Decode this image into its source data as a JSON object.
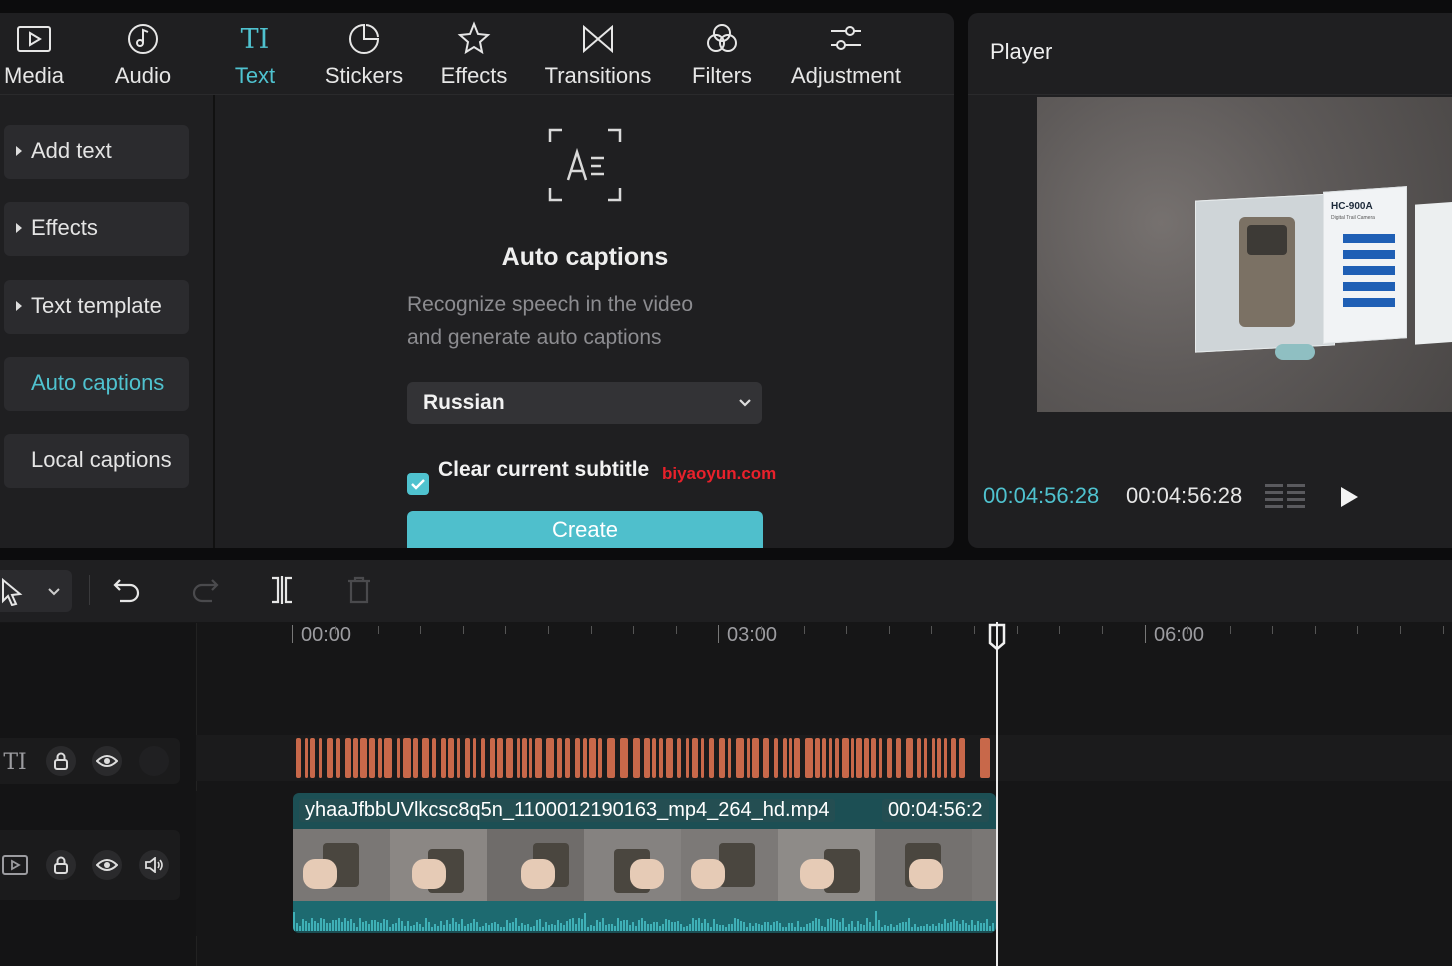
{
  "tabs": [
    {
      "label": "Media",
      "icon": "media-icon"
    },
    {
      "label": "Audio",
      "icon": "audio-icon"
    },
    {
      "label": "Text",
      "icon": "text-icon",
      "active": true
    },
    {
      "label": "Stickers",
      "icon": "stickers-icon"
    },
    {
      "label": "Effects",
      "icon": "effects-icon"
    },
    {
      "label": "Transitions",
      "icon": "transitions-icon"
    },
    {
      "label": "Filters",
      "icon": "filters-icon"
    },
    {
      "label": "Adjustment",
      "icon": "adjustment-icon"
    }
  ],
  "sidebar": {
    "items": [
      {
        "label": "Add text"
      },
      {
        "label": "Effects"
      },
      {
        "label": "Text template"
      },
      {
        "label": "Auto captions",
        "active": true
      },
      {
        "label": "Local captions"
      }
    ]
  },
  "auto_captions": {
    "title": "Auto captions",
    "desc_line1": "Recognize speech in the video",
    "desc_line2": "and generate auto captions",
    "language": "Russian",
    "clear_label": "Clear current subtitle",
    "clear_checked": true,
    "create_label": "Create"
  },
  "watermark": "biyaoyun.com",
  "player": {
    "title": "Player",
    "current_time": "00:04:56:28",
    "total_time": "00:04:56:28",
    "box_text": "HC-900A",
    "box_subtitle": "Digital Trail Camera"
  },
  "timeline": {
    "ruler": [
      "00:00",
      "03:00",
      "06:00"
    ],
    "clip_name": "yhaaJfbbUVlkcsc8q5n_1100012190163_mp4_264_hd.mp4",
    "clip_duration": "00:04:56:2"
  },
  "colors": {
    "accent": "#4fc2cf",
    "caption_track": "#c8684a",
    "audio_wave": "#2e8f95",
    "watermark": "#e8212b"
  }
}
